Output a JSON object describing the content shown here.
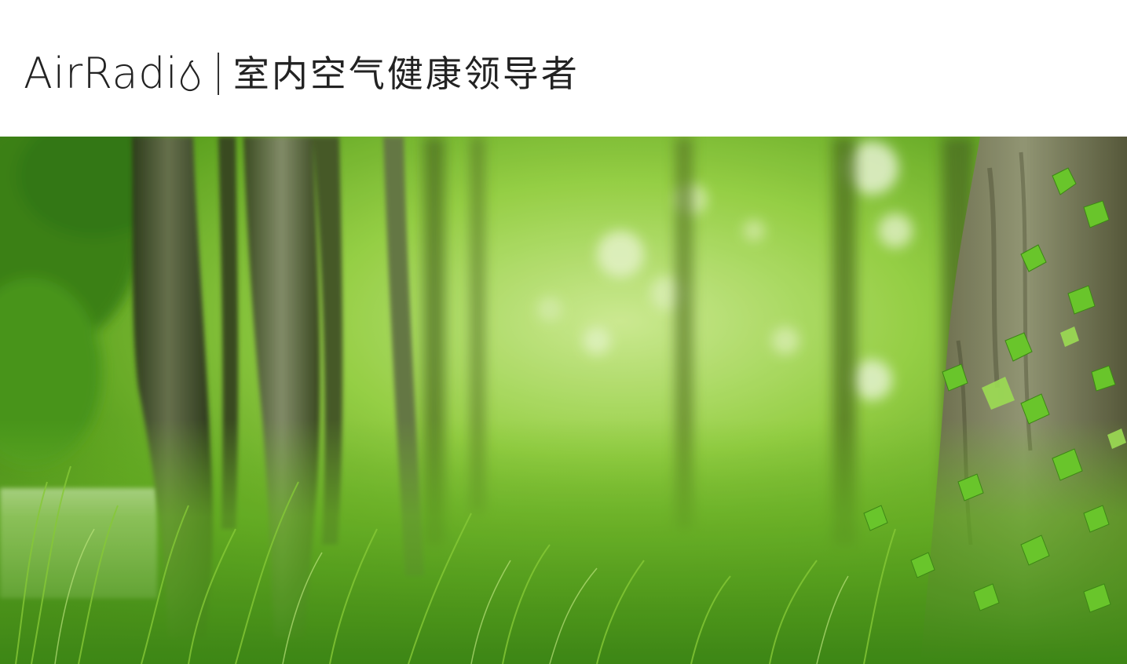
{
  "header": {
    "brand_name": "AirRadi",
    "logo_icon": "airradio-o-drop-icon",
    "tagline": "室内空气健康领导者"
  },
  "hero": {
    "image": "forest-photo",
    "colors": {
      "primary_green": "#6cbf2a",
      "light_green": "#b8e86a",
      "bark": "#5a5a3a"
    }
  }
}
